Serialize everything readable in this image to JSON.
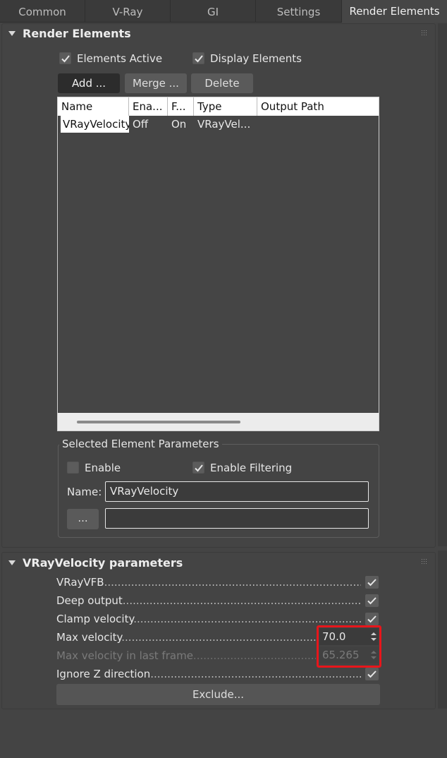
{
  "tabs": [
    "Common",
    "V-Ray",
    "GI",
    "Settings",
    "Render Elements"
  ],
  "active_tab": "Render Elements",
  "render_elements": {
    "title": "Render Elements",
    "elements_active_label": "Elements Active",
    "elements_active_checked": true,
    "display_elements_label": "Display Elements",
    "display_elements_checked": true,
    "buttons": {
      "add": "Add ...",
      "merge": "Merge ...",
      "delete": "Delete"
    },
    "list": {
      "columns": [
        "Name",
        "Ena...",
        "F...",
        "Type",
        "Output Path"
      ],
      "rows": [
        {
          "name": "VRayVelocity",
          "enabled": "Off",
          "filter": "On",
          "type": "VRayVel...",
          "output_path": ""
        }
      ]
    },
    "selected_params": {
      "title": "Selected Element Parameters",
      "enable_label": "Enable",
      "enable_checked": false,
      "enable_filtering_label": "Enable Filtering",
      "enable_filtering_checked": true,
      "name_label": "Name:",
      "name_value": "VRayVelocity",
      "browse_button": "...",
      "path_value": ""
    }
  },
  "velocity_params": {
    "title": "VRayVelocity parameters",
    "vrayvfb_label": "VRayVFB",
    "deep_output_label": "Deep output",
    "clamp_velocity_label": "Clamp velocity",
    "max_velocity_label": "Max velocity",
    "max_velocity_value": "70.0",
    "max_velocity_last_frame_label": "Max velocity in last frame",
    "max_velocity_last_frame_value": "65.265",
    "ignore_z_label": "Ignore Z direction",
    "exclude_button": "Exclude..."
  },
  "colors": {
    "highlight": "#e8151b",
    "panel": "#444444"
  }
}
